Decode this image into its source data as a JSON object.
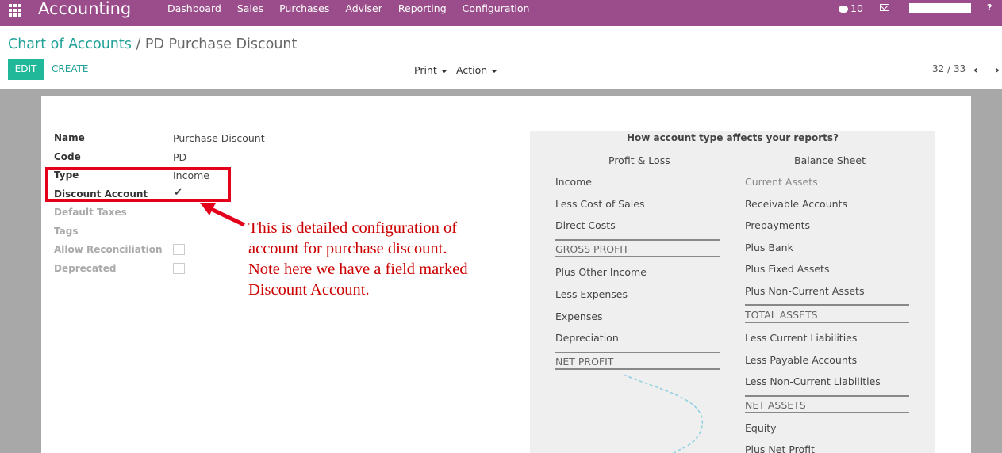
{
  "navbar": {
    "app_title": "Accounting",
    "menu": [
      "Dashboard",
      "Sales",
      "Purchases",
      "Adviser",
      "Reporting",
      "Configuration"
    ],
    "messages_count": "10",
    "help_label": "?"
  },
  "breadcrumb": {
    "parent": "Chart of Accounts",
    "separator": "/",
    "current": "PD Purchase Discount"
  },
  "toolbar": {
    "edit_label": "EDIT",
    "create_label": "CREATE",
    "print_label": "Print",
    "action_label": "Action"
  },
  "pager": {
    "text": "32 / 33",
    "prev": "‹",
    "next": "›"
  },
  "form": {
    "name_label": "Name",
    "name_value": "Purchase Discount",
    "code_label": "Code",
    "code_value": "PD",
    "type_label": "Type",
    "type_value": "Income",
    "discount_label": "Discount Account",
    "discount_checked": true,
    "default_taxes_label": "Default Taxes",
    "tags_label": "Tags",
    "reconcile_label": "Allow Reconciliation",
    "reconcile_checked": false,
    "deprecated_label": "Deprecated",
    "deprecated_checked": false
  },
  "annotation": {
    "lines": [
      "This is detailed configuration of",
      "account for purchase discount.",
      "Note here we have a field marked",
      "Discount Account."
    ],
    "color": "#cc0000"
  },
  "info_panel": {
    "title": "How account type affects your reports?",
    "pl_heading": "Profit & Loss",
    "bs_heading": "Balance Sheet",
    "pl_items": [
      "Income",
      "Less Cost of Sales",
      "Direct Costs",
      "GROSS PROFIT",
      "Plus Other Income",
      "Less Expenses",
      "Expenses",
      "Depreciation",
      "NET PROFIT"
    ],
    "bs_items": [
      "Current Assets",
      "Receivable Accounts",
      "Prepayments",
      "Plus Bank",
      "Plus Fixed Assets",
      "Plus Non-Current Assets",
      "TOTAL ASSETS",
      "Less Current Liabilities",
      "Less Payable Accounts",
      "Less Non-Current Liabilities",
      "NET ASSETS",
      "Equity",
      "Plus Net Profit"
    ]
  },
  "colors": {
    "navbar": "#9a4d8a",
    "primary": "#21b799",
    "link": "#20a198",
    "highlight": "#e4001b"
  }
}
